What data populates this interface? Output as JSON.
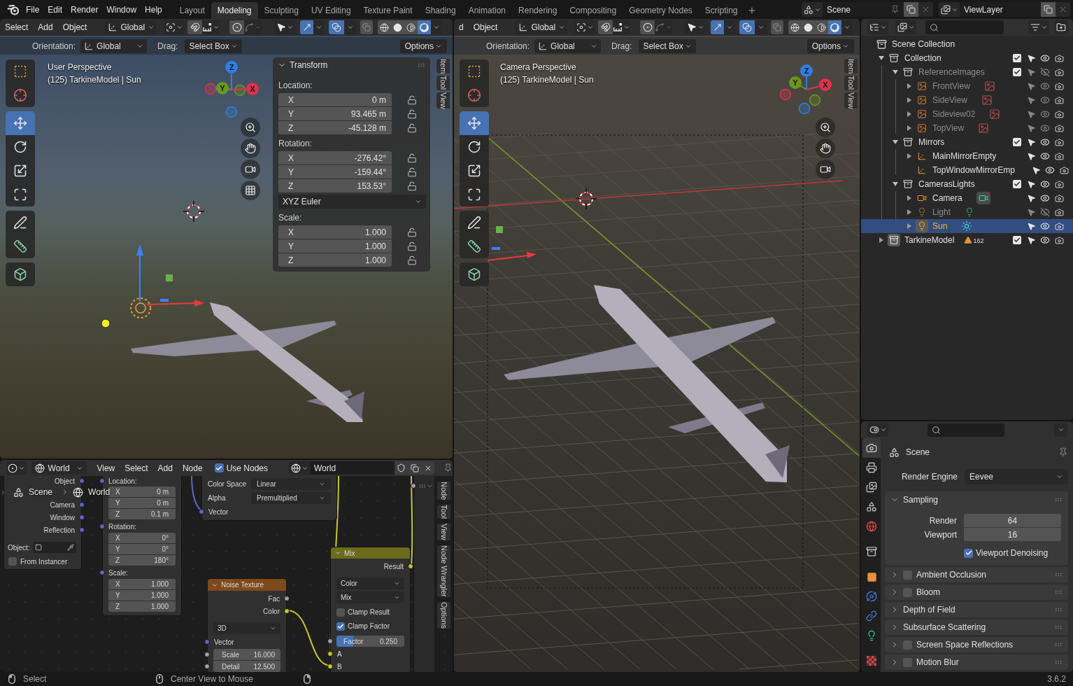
{
  "top_bar": {
    "menus": [
      "File",
      "Edit",
      "Render",
      "Window",
      "Help"
    ],
    "workspaces": [
      {
        "label": "Layout",
        "selected": false
      },
      {
        "label": "Modeling",
        "selected": true
      },
      {
        "label": "Sculpting",
        "selected": false
      },
      {
        "label": "UV Editing",
        "selected": false
      },
      {
        "label": "Texture Paint",
        "selected": false
      },
      {
        "label": "Shading",
        "selected": false
      },
      {
        "label": "Animation",
        "selected": false
      },
      {
        "label": "Rendering",
        "selected": false
      },
      {
        "label": "Compositing",
        "selected": false
      },
      {
        "label": "Geometry Nodes",
        "selected": false
      },
      {
        "label": "Scripting",
        "selected": false
      }
    ],
    "scene": "Scene",
    "view_layer": "ViewLayer"
  },
  "viewport_left": {
    "menus": [
      "Select",
      "Add",
      "Object"
    ],
    "orientation": "Global",
    "toggles": {
      "snap": false,
      "proportional": false,
      "gizmos": true,
      "overlays": true,
      "xray": false
    },
    "shading": [
      {
        "kind": "wireframe",
        "selected": false
      },
      {
        "kind": "solid",
        "selected": false
      },
      {
        "kind": "material",
        "selected": false
      },
      {
        "kind": "rendered",
        "selected": true
      }
    ],
    "tool_settings": {
      "orientation_label": "Orientation:",
      "orientation": "Global",
      "drag_label": "Drag:",
      "drag": "Select Box",
      "options": "Options"
    },
    "info": [
      "User Perspective",
      "(125) TarkineModel | Sun"
    ],
    "tools": [
      [
        {
          "kind": "select_box",
          "selected": false
        },
        {
          "kind": "cursor",
          "selected": false
        }
      ],
      [
        {
          "kind": "move",
          "selected": true
        },
        {
          "kind": "rotate",
          "selected": false
        },
        {
          "kind": "scale",
          "selected": false
        },
        {
          "kind": "transform",
          "selected": false
        }
      ],
      [
        {
          "kind": "annotate",
          "selected": false
        },
        {
          "kind": "measure",
          "selected": false
        }
      ],
      [
        {
          "kind": "add_cube",
          "selected": false
        }
      ]
    ],
    "gizmo_axes": [
      {
        "label": "Z",
        "color": "#2f7fe0"
      },
      {
        "label": "Y",
        "color": "#6a961f"
      },
      {
        "label": "X",
        "color": "#df3149"
      }
    ],
    "nav_buttons": [
      {
        "kind": "zoom"
      },
      {
        "kind": "pan"
      },
      {
        "kind": "camera"
      },
      {
        "kind": "ortho"
      }
    ],
    "side_tabs": [
      "Item",
      "Tool",
      "View"
    ],
    "transform": {
      "title": "Transform",
      "expanded": true,
      "groups": [
        {
          "label": "Location:",
          "fields": [
            {
              "axis": "X",
              "value": "0 m"
            },
            {
              "axis": "Y",
              "value": "93.465 m"
            },
            {
              "axis": "Z",
              "value": "-45.128 m"
            }
          ]
        },
        {
          "label": "Rotation:",
          "fields": [
            {
              "axis": "X",
              "value": "-276.42°"
            },
            {
              "axis": "Y",
              "value": "-159.44°"
            },
            {
              "axis": "Z",
              "value": "153.53°"
            }
          ],
          "mode": "XYZ Euler"
        },
        {
          "label": "Scale:",
          "fields": [
            {
              "axis": "X",
              "value": "1.000"
            },
            {
              "axis": "Y",
              "value": "1.000"
            },
            {
              "axis": "Z",
              "value": "1.000"
            }
          ]
        }
      ]
    }
  },
  "viewport_right": {
    "menus": [
      "d",
      "Object"
    ],
    "orientation": "Global",
    "toggles": {
      "snap": false,
      "proportional": false,
      "gizmos": true,
      "overlays": true,
      "xray": false
    },
    "shading": [
      {
        "kind": "wireframe",
        "selected": false
      },
      {
        "kind": "solid",
        "selected": false
      },
      {
        "kind": "material",
        "selected": false
      },
      {
        "kind": "rendered",
        "selected": true
      }
    ],
    "tool_settings": {
      "orientation_label": "Orientation:",
      "orientation": "Global",
      "drag_label": "Drag:",
      "drag": "Select Box",
      "options": "Options"
    },
    "info": [
      "Camera Perspective",
      "(125) TarkineModel | Sun"
    ],
    "tools": [
      [
        {
          "kind": "select_box",
          "selected": false
        },
        {
          "kind": "cursor",
          "selected": false
        }
      ],
      [
        {
          "kind": "move",
          "selected": true
        },
        {
          "kind": "rotate",
          "selected": false
        },
        {
          "kind": "scale",
          "selected": false
        },
        {
          "kind": "transform",
          "selected": false
        }
      ],
      [
        {
          "kind": "annotate",
          "selected": false
        },
        {
          "kind": "measure",
          "selected": false
        }
      ],
      [
        {
          "kind": "add_cube",
          "selected": false
        }
      ]
    ],
    "gizmo_axes": [
      {
        "label": "Z",
        "color": "#2f7fe0"
      },
      {
        "label": "Y",
        "color": "#6a961f"
      },
      {
        "label": "X",
        "color": "#df3149"
      }
    ],
    "nav_buttons": [
      {
        "kind": "zoom"
      },
      {
        "kind": "pan"
      },
      {
        "kind": "camera"
      }
    ],
    "side_tabs": [
      "Item",
      "Tool",
      "View"
    ]
  },
  "node_editor": {
    "shader_type": "World",
    "menus": [
      "View",
      "Select",
      "Add",
      "Node"
    ],
    "use_nodes": {
      "label": "Use Nodes",
      "checked": true
    },
    "world": "World",
    "breadcrumbs": [
      "Scene",
      "World"
    ],
    "nodes": [
      {
        "kind": "texture_coordinate",
        "outputs": [
          "Object",
          "Camera",
          "Window",
          "Reflection"
        ],
        "object_label": "Object:",
        "from_instancer": {
          "label": "From Instancer",
          "checked": false
        }
      },
      {
        "kind": "mapping",
        "groups": [
          {
            "label": "Location:",
            "fields": [
              {
                "axis": "X",
                "value": "0 m"
              },
              {
                "axis": "Y",
                "value": "0 m"
              },
              {
                "axis": "Z",
                "value": "0.1 m"
              }
            ]
          },
          {
            "label": "Rotation:",
            "fields": [
              {
                "axis": "X",
                "value": "0°"
              },
              {
                "axis": "Y",
                "value": "0°"
              },
              {
                "axis": "Z",
                "value": "180°"
              }
            ]
          },
          {
            "label": "Scale:",
            "fields": [
              {
                "axis": "X",
                "value": "1.000"
              },
              {
                "axis": "Y",
                "value": "1.000"
              },
              {
                "axis": "Z",
                "value": "1.000"
              }
            ]
          }
        ]
      },
      {
        "kind": "image_texture",
        "settings": [
          {
            "label": "Color Space",
            "value": "Linear"
          },
          {
            "label": "Alpha",
            "value": "Premultiplied"
          }
        ],
        "inputs": [
          "Vector"
        ]
      },
      {
        "kind": "noise_texture",
        "title": "Noise Texture",
        "outputs": [
          "Fac",
          "Color"
        ],
        "dimensions": "3D",
        "inputs": [
          "Vector"
        ],
        "fields": [
          {
            "label": "Scale",
            "value": "16.000"
          },
          {
            "label": "Detail",
            "value": "12.500"
          }
        ]
      },
      {
        "kind": "mix",
        "title": "Mix",
        "outputs": [
          "Result"
        ],
        "dropdowns": [
          "Color",
          "Mix"
        ],
        "checkboxes": [
          {
            "label": "Clamp Result",
            "checked": false
          },
          {
            "label": "Clamp Factor",
            "checked": true
          }
        ],
        "factor": {
          "label": "Factor",
          "value": "0.250",
          "level": 0.25
        },
        "inputs": [
          "A",
          "B"
        ]
      }
    ],
    "side_tabs": [
      "Node",
      "Tool",
      "View",
      "Node Wrangler",
      "Options"
    ]
  },
  "outliner": {
    "root": "Scene Collection",
    "items": [
      {
        "name": "Collection",
        "kind": "collection",
        "expanded": true,
        "active": false,
        "checked": true,
        "visible": true,
        "selected": false,
        "children": [
          {
            "name": "ReferenceImages",
            "kind": "collection",
            "expanded": true,
            "active": false,
            "checked": true,
            "visible": false,
            "selected": false,
            "children": [
              {
                "name": "FrontView",
                "kind": "image_empty",
                "expanded": false,
                "active": false,
                "visible": true,
                "selected": false
              },
              {
                "name": "SideView",
                "kind": "image_empty",
                "expanded": false,
                "active": false,
                "visible": true,
                "selected": false
              },
              {
                "name": "Sideview02",
                "kind": "image_empty",
                "expanded": false,
                "active": false,
                "visible": true,
                "selected": false
              },
              {
                "name": "TopView",
                "kind": "image_empty",
                "expanded": false,
                "active": false,
                "visible": true,
                "selected": false
              }
            ]
          },
          {
            "name": "Mirrors",
            "kind": "collection",
            "expanded": true,
            "active": false,
            "checked": true,
            "visible": true,
            "selected": false,
            "children": [
              {
                "name": "MainMirrorEmpty",
                "kind": "empty",
                "expanded": false,
                "active": false,
                "visible": true,
                "selected": false
              },
              {
                "name": "TopWindowMirrorEmp",
                "kind": "empty",
                "active": false,
                "visible": true,
                "selected": false
              }
            ]
          },
          {
            "name": "CamerasLights",
            "kind": "collection",
            "expanded": true,
            "active": false,
            "checked": true,
            "visible": true,
            "selected": false,
            "children": [
              {
                "name": "Camera",
                "kind": "camera",
                "expanded": false,
                "active": false,
                "visible": true,
                "selected": false
              },
              {
                "name": "Light",
                "kind": "light",
                "expanded": false,
                "active": false,
                "visible": false,
                "selected": false
              },
              {
                "name": "Sun",
                "kind": "sun",
                "expanded": false,
                "active": true,
                "visible": true,
                "selected": true
              }
            ]
          }
        ]
      },
      {
        "name": "TarkineModel",
        "kind": "collection",
        "expanded": false,
        "active": true,
        "checked": true,
        "visible": true,
        "selected": false,
        "count": "162"
      }
    ]
  },
  "properties": {
    "tabs": [
      [
        {
          "kind": "render",
          "selected": true
        },
        {
          "kind": "output",
          "selected": false
        },
        {
          "kind": "view_layer",
          "selected": false
        },
        {
          "kind": "scene",
          "selected": false
        },
        {
          "kind": "world",
          "selected": false
        }
      ],
      [
        {
          "kind": "collection",
          "selected": false
        }
      ],
      [
        {
          "kind": "object",
          "selected": false
        },
        {
          "kind": "physics",
          "selected": false
        },
        {
          "kind": "constraints",
          "selected": false
        },
        {
          "kind": "light",
          "selected": false
        }
      ],
      [
        {
          "kind": "texture",
          "selected": false
        }
      ]
    ],
    "context": "Scene",
    "render_engine": {
      "label": "Render Engine",
      "value": "Eevee"
    },
    "panels": [
      {
        "title": "Sampling",
        "expanded": true,
        "fields": [
          {
            "label": "Render",
            "value": "64"
          },
          {
            "label": "Viewport",
            "value": "16"
          }
        ],
        "checkbox": {
          "label": "Viewport Denoising",
          "checked": true
        }
      },
      {
        "title": "Ambient Occlusion",
        "expanded": false,
        "checked": false
      },
      {
        "title": "Bloom",
        "expanded": false,
        "checked": false
      },
      {
        "title": "Depth of Field",
        "expanded": false
      },
      {
        "title": "Subsurface Scattering",
        "expanded": false
      },
      {
        "title": "Screen Space Reflections",
        "expanded": false,
        "checked": false
      },
      {
        "title": "Motion Blur",
        "expanded": false,
        "checked": false
      }
    ]
  },
  "status_bar": {
    "hints": [
      {
        "kind": "left",
        "label": "Select"
      },
      {
        "kind": "middle",
        "label": "Center View to Mouse"
      },
      {
        "kind": "right"
      }
    ],
    "version": "3.6.2"
  }
}
